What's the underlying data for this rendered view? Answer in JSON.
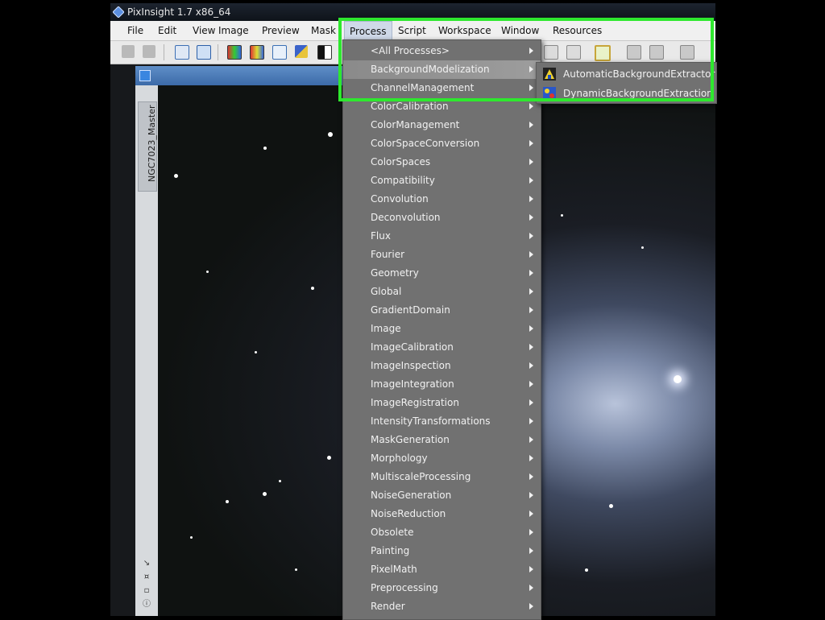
{
  "window": {
    "title": "PixInsight 1.7 x86_64"
  },
  "menubar": {
    "items": [
      "File",
      "Edit",
      "View",
      "Image",
      "Preview",
      "Mask",
      "Process",
      "Script",
      "Workspace",
      "Window",
      "Resources"
    ],
    "active": "Process"
  },
  "image_window": {
    "view_tab_label": "NGC7023_Master"
  },
  "process_menu": {
    "items": [
      "<All Processes>",
      "BackgroundModelization",
      "ChannelManagement",
      "ColorCalibration",
      "ColorManagement",
      "ColorSpaceConversion",
      "ColorSpaces",
      "Compatibility",
      "Convolution",
      "Deconvolution",
      "Flux",
      "Fourier",
      "Geometry",
      "Global",
      "GradientDomain",
      "Image",
      "ImageCalibration",
      "ImageInspection",
      "ImageIntegration",
      "ImageRegistration",
      "IntensityTransformations",
      "MaskGeneration",
      "Morphology",
      "MultiscaleProcessing",
      "NoiseGeneration",
      "NoiseReduction",
      "Obsolete",
      "Painting",
      "PixelMath",
      "Preprocessing",
      "Render"
    ],
    "highlighted": "BackgroundModelization"
  },
  "background_submenu": {
    "items": [
      {
        "label": "AutomaticBackgroundExtractor",
        "icon": "abe-icon"
      },
      {
        "label": "DynamicBackgroundExtraction",
        "icon": "dbe-icon"
      }
    ]
  },
  "colors": {
    "highlight_box": "#2ee82e",
    "menu_bg": "#717171",
    "menu_text": "#f1f1f1"
  }
}
